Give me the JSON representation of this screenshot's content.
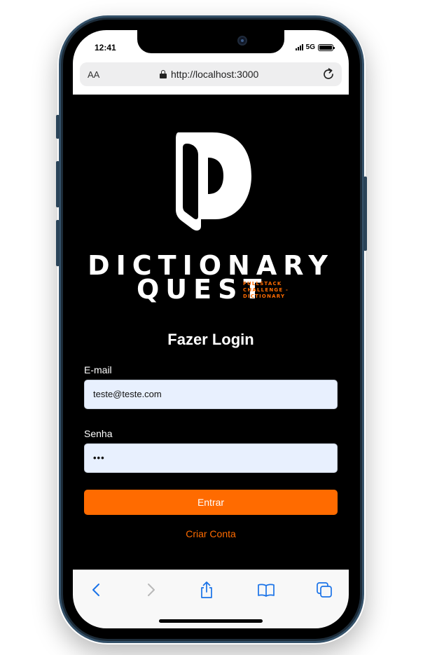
{
  "status_bar": {
    "time": "12:41",
    "network": "5G"
  },
  "browser": {
    "text_size_label": "AA",
    "url": "http://localhost:3000"
  },
  "brand": {
    "line1": "DICTIONARY",
    "line2": "QUEST",
    "tagline": "FULLSTACK CHALLENGE - DICTIONARY"
  },
  "login_form": {
    "title": "Fazer Login",
    "email_label": "E-mail",
    "email_value": "teste@teste.com",
    "password_label": "Senha",
    "password_value": "•••",
    "submit_label": "Entrar",
    "create_account_label": "Criar Conta"
  },
  "colors": {
    "accent": "#ff6b00",
    "page_background": "#000000",
    "input_background": "#e8f0fe",
    "safari_blue": "#1a73e8"
  },
  "toolbar": {
    "icons": [
      "back-icon",
      "forward-icon",
      "share-icon",
      "bookmarks-icon",
      "tabs-icon"
    ]
  }
}
